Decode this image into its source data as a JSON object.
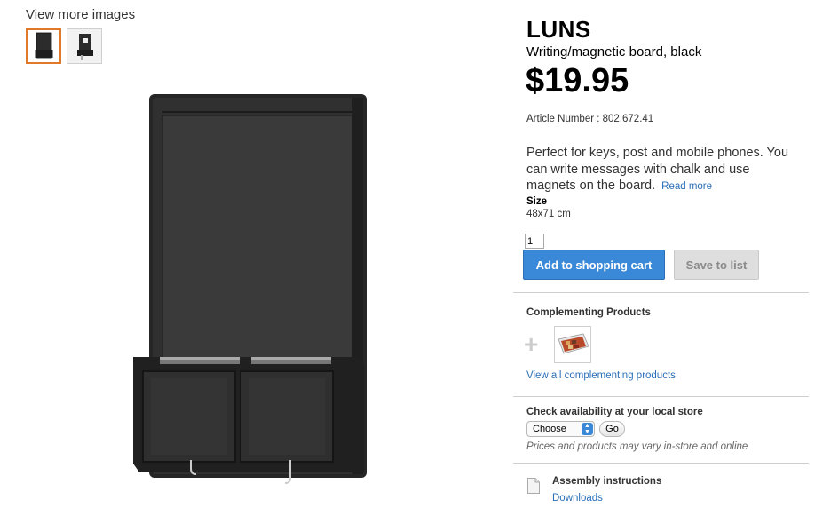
{
  "gallery": {
    "view_more_label": "View more images",
    "thumbnails": [
      {
        "icon": "board-thumbnail",
        "selected": true
      },
      {
        "icon": "board-in-use-thumbnail",
        "selected": false
      }
    ],
    "main_image": "black-writing-magnetic-board"
  },
  "product": {
    "name": "LUNS",
    "subtitle": "Writing/magnetic board, black",
    "price": "$19.95",
    "article_number": "Article Number : 802.672.41",
    "description": "Perfect for keys, post and mobile phones. You can write messages with chalk and use magnets on the board.",
    "read_more": "Read more",
    "size_label": "Size",
    "size_value": "48x71 cm"
  },
  "purchase": {
    "quantity": "1",
    "add_to_cart": "Add to shopping cart",
    "save_to_list": "Save to list"
  },
  "complementing": {
    "title": "Complementing Products",
    "plus": "+",
    "view_all": "View all complementing products"
  },
  "availability": {
    "title": "Check availability at your local store",
    "select_value": "Choose",
    "go": "Go",
    "note": "Prices and products may vary in-store and online"
  },
  "assembly": {
    "title": "Assembly instructions",
    "link": "Downloads"
  },
  "colors": {
    "primary_button": "#3a88d8",
    "link": "#2a6fb8",
    "selected_thumb_border": "#e07a2a"
  }
}
